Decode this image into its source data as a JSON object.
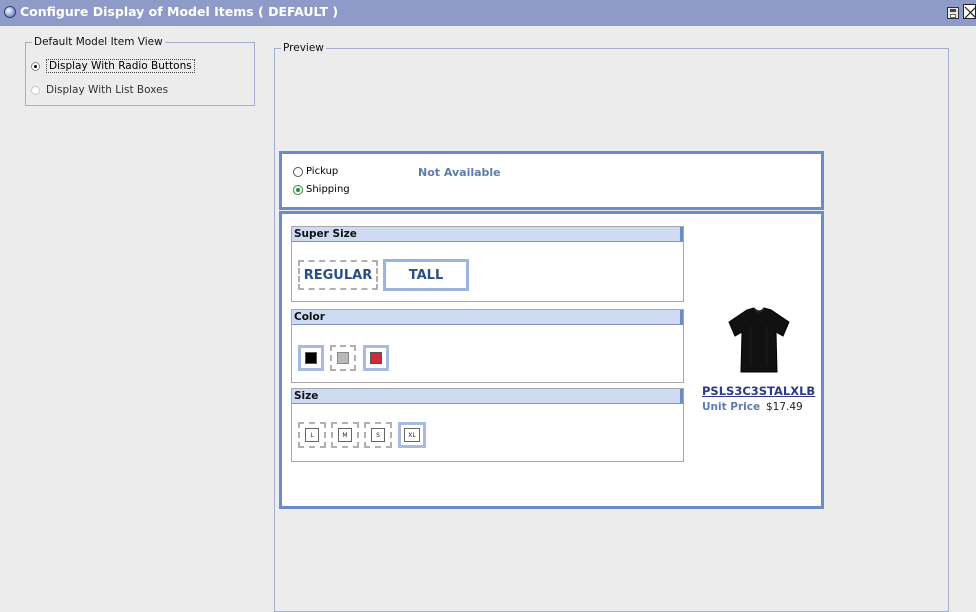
{
  "window": {
    "title": "Configure Display of Model Items ( DEFAULT )",
    "icons": {
      "title": "globe-icon",
      "save": "save-icon",
      "close": "close-icon"
    },
    "colors": {
      "titlebar": "#8e9bc8",
      "panel_border": "#6d8cc7",
      "link": "#2b3b86"
    }
  },
  "default_view": {
    "legend": "Default Model Item View",
    "options": [
      {
        "label": "Display With Radio Buttons",
        "selected": true
      },
      {
        "label": "Display With List Boxes",
        "selected": false
      }
    ]
  },
  "preview": {
    "legend": "Preview",
    "delivery": {
      "options": [
        {
          "label": "Pickup",
          "selected": false
        },
        {
          "label": "Shipping",
          "selected": true
        }
      ],
      "status": "Not Available"
    },
    "attributes": {
      "super_size": {
        "title": "Super Size",
        "options": [
          "REGULAR",
          "TALL"
        ],
        "selected": "TALL"
      },
      "color": {
        "title": "Color",
        "swatches": [
          "#000000",
          "#b9b9b9",
          "#cc2b3c"
        ],
        "selected": "#000000"
      },
      "size": {
        "title": "Size",
        "options": [
          "L",
          "M",
          "S",
          "XL"
        ],
        "selected": "XL"
      }
    },
    "product": {
      "sku": "PSLS3C3STALXLB",
      "unit_price_label": "Unit Price",
      "unit_price": "$17.49",
      "image": "black-tshirt-image"
    }
  }
}
